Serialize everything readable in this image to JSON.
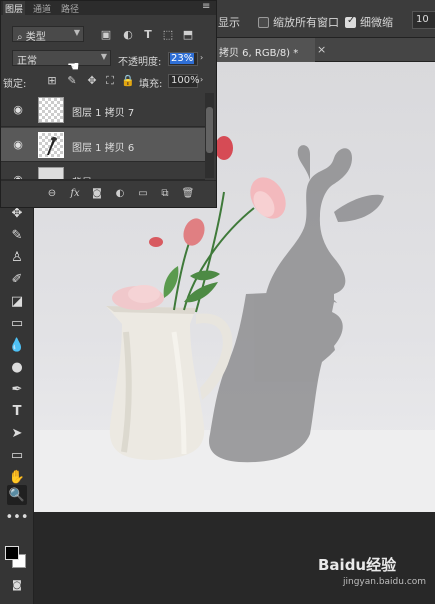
{
  "options_bar": {
    "sample_all_windows": "显示",
    "zoom_all_windows": "缩放所有窗口",
    "scrubby_zoom": "细微缩",
    "scrubby_checked": true,
    "zoom_value": "10"
  },
  "document_tab": {
    "title": "拷贝 6, RGB/8) *",
    "close": "×"
  },
  "layers_panel": {
    "tabs": [
      "图层",
      "通道",
      "路径"
    ],
    "menu_icon": "hamburger-icon",
    "filter_kind": "类型",
    "blend_mode": "正常",
    "opacity_label": "不透明度:",
    "opacity_value": "23%",
    "lock_label": "锁定:",
    "fill_label": "填充:",
    "fill_value": "100%",
    "layers": [
      {
        "name": "图层 1 拷贝 7",
        "visible": true,
        "selected": false
      },
      {
        "name": "图层 1 拷贝 6",
        "visible": true,
        "selected": true
      },
      {
        "name": "背景",
        "visible": true,
        "selected": false
      }
    ]
  },
  "tools": [
    "move-icon",
    "brush-icon",
    "stamp-icon",
    "history-brush-icon",
    "eraser-icon",
    "gradient-icon",
    "blur-icon",
    "dodge-icon",
    "pen-icon",
    "type-icon",
    "path-select-icon",
    "rectangle-icon",
    "hand-icon",
    "zoom-icon",
    "more-icon"
  ],
  "colors": {
    "foreground": "#000000",
    "background": "#ffffff",
    "selection_highlight": "#2f6fd6"
  },
  "watermark": {
    "brand": "Baidu经验",
    "url": "jingyan.baidu.com"
  }
}
